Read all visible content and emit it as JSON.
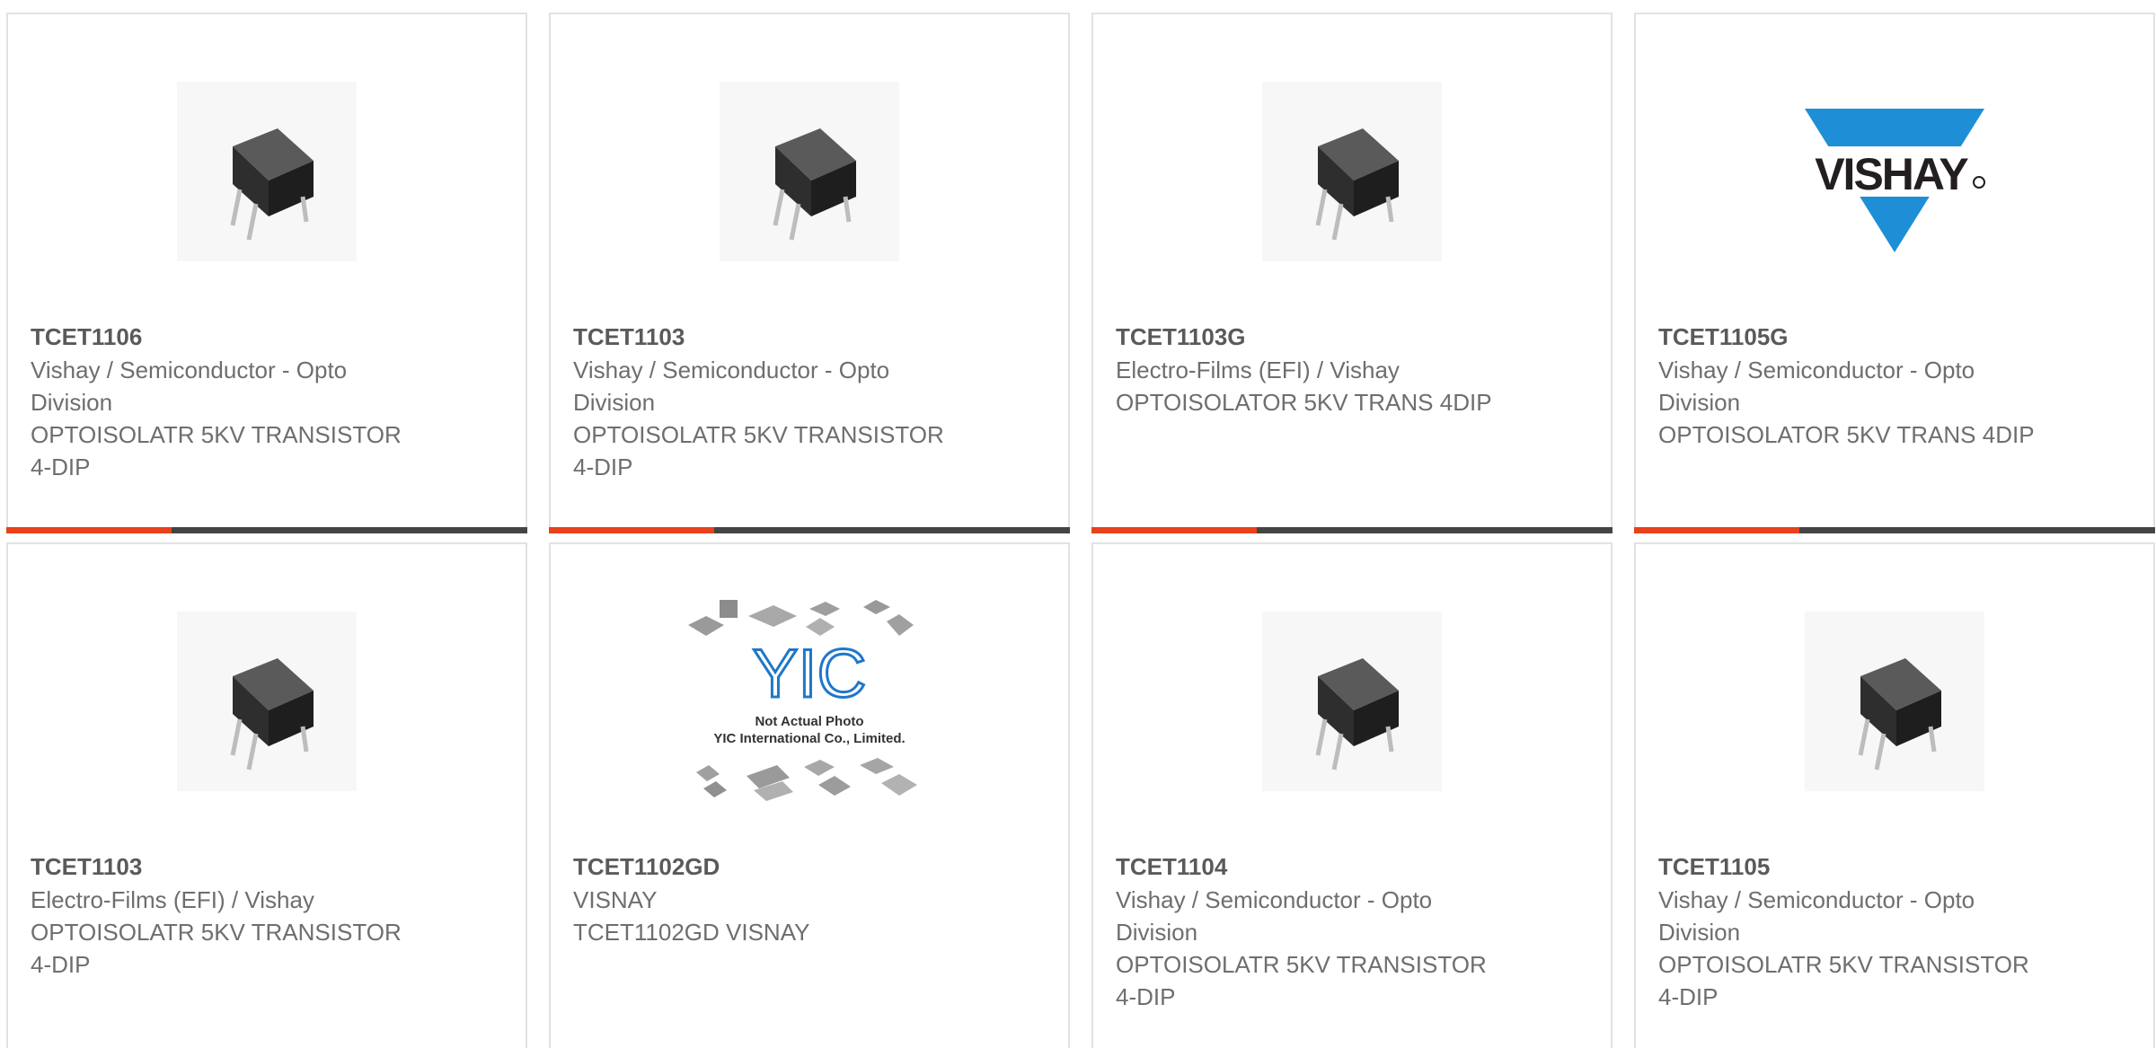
{
  "products": [
    {
      "part": "TCET1106",
      "manufacturer": "Vishay / Semiconductor - Opto Division",
      "description": "OPTOISOLATR 5KV TRANSISTOR 4-DIP",
      "image": "optocoupler-dip4-photo"
    },
    {
      "part": "TCET1103",
      "manufacturer": "Vishay / Semiconductor - Opto Division",
      "description": "OPTOISOLATR 5KV TRANSISTOR 4-DIP",
      "image": "optocoupler-dip4-photo"
    },
    {
      "part": "TCET1103G",
      "manufacturer": "Electro-Films (EFI) / Vishay",
      "description": "OPTOISOLATOR 5KV TRANS 4DIP",
      "image": "optocoupler-dip4-photo"
    },
    {
      "part": "TCET1105G",
      "manufacturer": "Vishay / Semiconductor - Opto Division",
      "description": "OPTOISOLATOR 5KV TRANS 4DIP",
      "image": "vishay-logo"
    },
    {
      "part": "TCET1103",
      "manufacturer": "Electro-Films (EFI) / Vishay",
      "description": "OPTOISOLATR 5KV TRANSISTOR 4-DIP",
      "image": "optocoupler-dip4-photo"
    },
    {
      "part": "TCET1102GD",
      "manufacturer": "VISNAY",
      "description": "TCET1102GD VISNAY",
      "image": "yic-placeholder"
    },
    {
      "part": "TCET1104",
      "manufacturer": "Vishay / Semiconductor - Opto Division",
      "description": "OPTOISOLATR 5KV TRANSISTOR 4-DIP",
      "image": "optocoupler-dip4-photo"
    },
    {
      "part": "TCET1105",
      "manufacturer": "Vishay / Semiconductor - Opto Division",
      "description": "OPTOISOLATR 5KV TRANSISTOR 4-DIP",
      "image": "optocoupler-dip4-photo"
    }
  ],
  "logos": {
    "vishay": "VISHAY",
    "yic_mark": "YIC",
    "yic_caption_1": "Not Actual Photo",
    "yic_caption_2": "YIC International Co., Limited."
  },
  "colors": {
    "accent_row1": "#e8411b",
    "accent_row2": "#e9a23b",
    "bar": "#444444",
    "vishay_blue": "#1e8fd6"
  }
}
